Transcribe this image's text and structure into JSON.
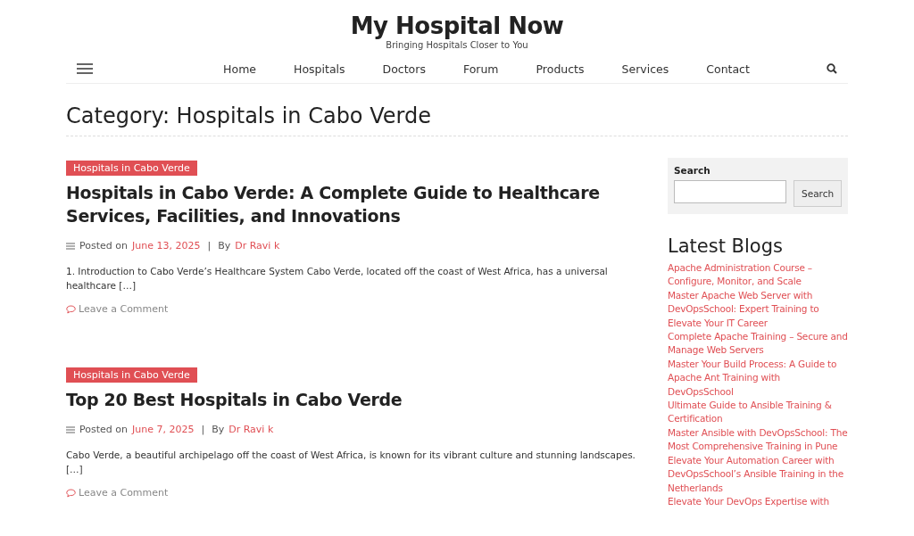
{
  "site": {
    "title": "My Hospital Now",
    "tagline": "Bringing Hospitals Closer to You"
  },
  "nav": [
    "Home",
    "Hospitals",
    "Doctors",
    "Forum",
    "Products",
    "Services",
    "Contact"
  ],
  "page_title": "Category: Hospitals in Cabo Verde",
  "posts": [
    {
      "category": "Hospitals in Cabo Verde",
      "title": "Hospitals in Cabo Verde: A Complete Guide to Healthcare Services, Facilities, and Innovations",
      "posted_label": "Posted on",
      "date": "June 13, 2025",
      "separator": "|",
      "by_label": "By",
      "author": "Dr Ravi k",
      "excerpt": "1. Introduction to Cabo Verde’s Healthcare System Cabo Verde, located off the coast of West Africa, has a universal healthcare […]",
      "comment_link": "Leave a Comment"
    },
    {
      "category": "Hospitals in Cabo Verde",
      "title": "Top 20 Best Hospitals in Cabo Verde",
      "posted_label": "Posted on",
      "date": "June 7, 2025",
      "separator": "|",
      "by_label": "By",
      "author": "Dr Ravi k",
      "excerpt": "Cabo Verde, a beautiful archipelago off the coast of West Africa, is known for its vibrant culture and stunning landscapes. […]",
      "comment_link": "Leave a Comment"
    }
  ],
  "sidebar": {
    "search": {
      "label": "Search",
      "button": "Search"
    },
    "latest_title": "Latest Blogs",
    "latest": [
      "Apache Administration Course – Configure, Monitor, and Scale",
      "Master Apache Web Server with DevOpsSchool: Expert Training to Elevate Your IT Career",
      "Complete Apache Training – Secure and Manage Web Servers",
      "Master Your Build Process: A Guide to Apache Ant Training with DevOpsSchool",
      "Ultimate Guide to Ansible Training & Certification",
      "Master Ansible with DevOpsSchool: The Most Comprehensive Training in Pune",
      "Elevate Your Automation Career with DevOpsSchool’s Ansible Training in the Netherlands",
      "Elevate Your DevOps Expertise with"
    ]
  }
}
